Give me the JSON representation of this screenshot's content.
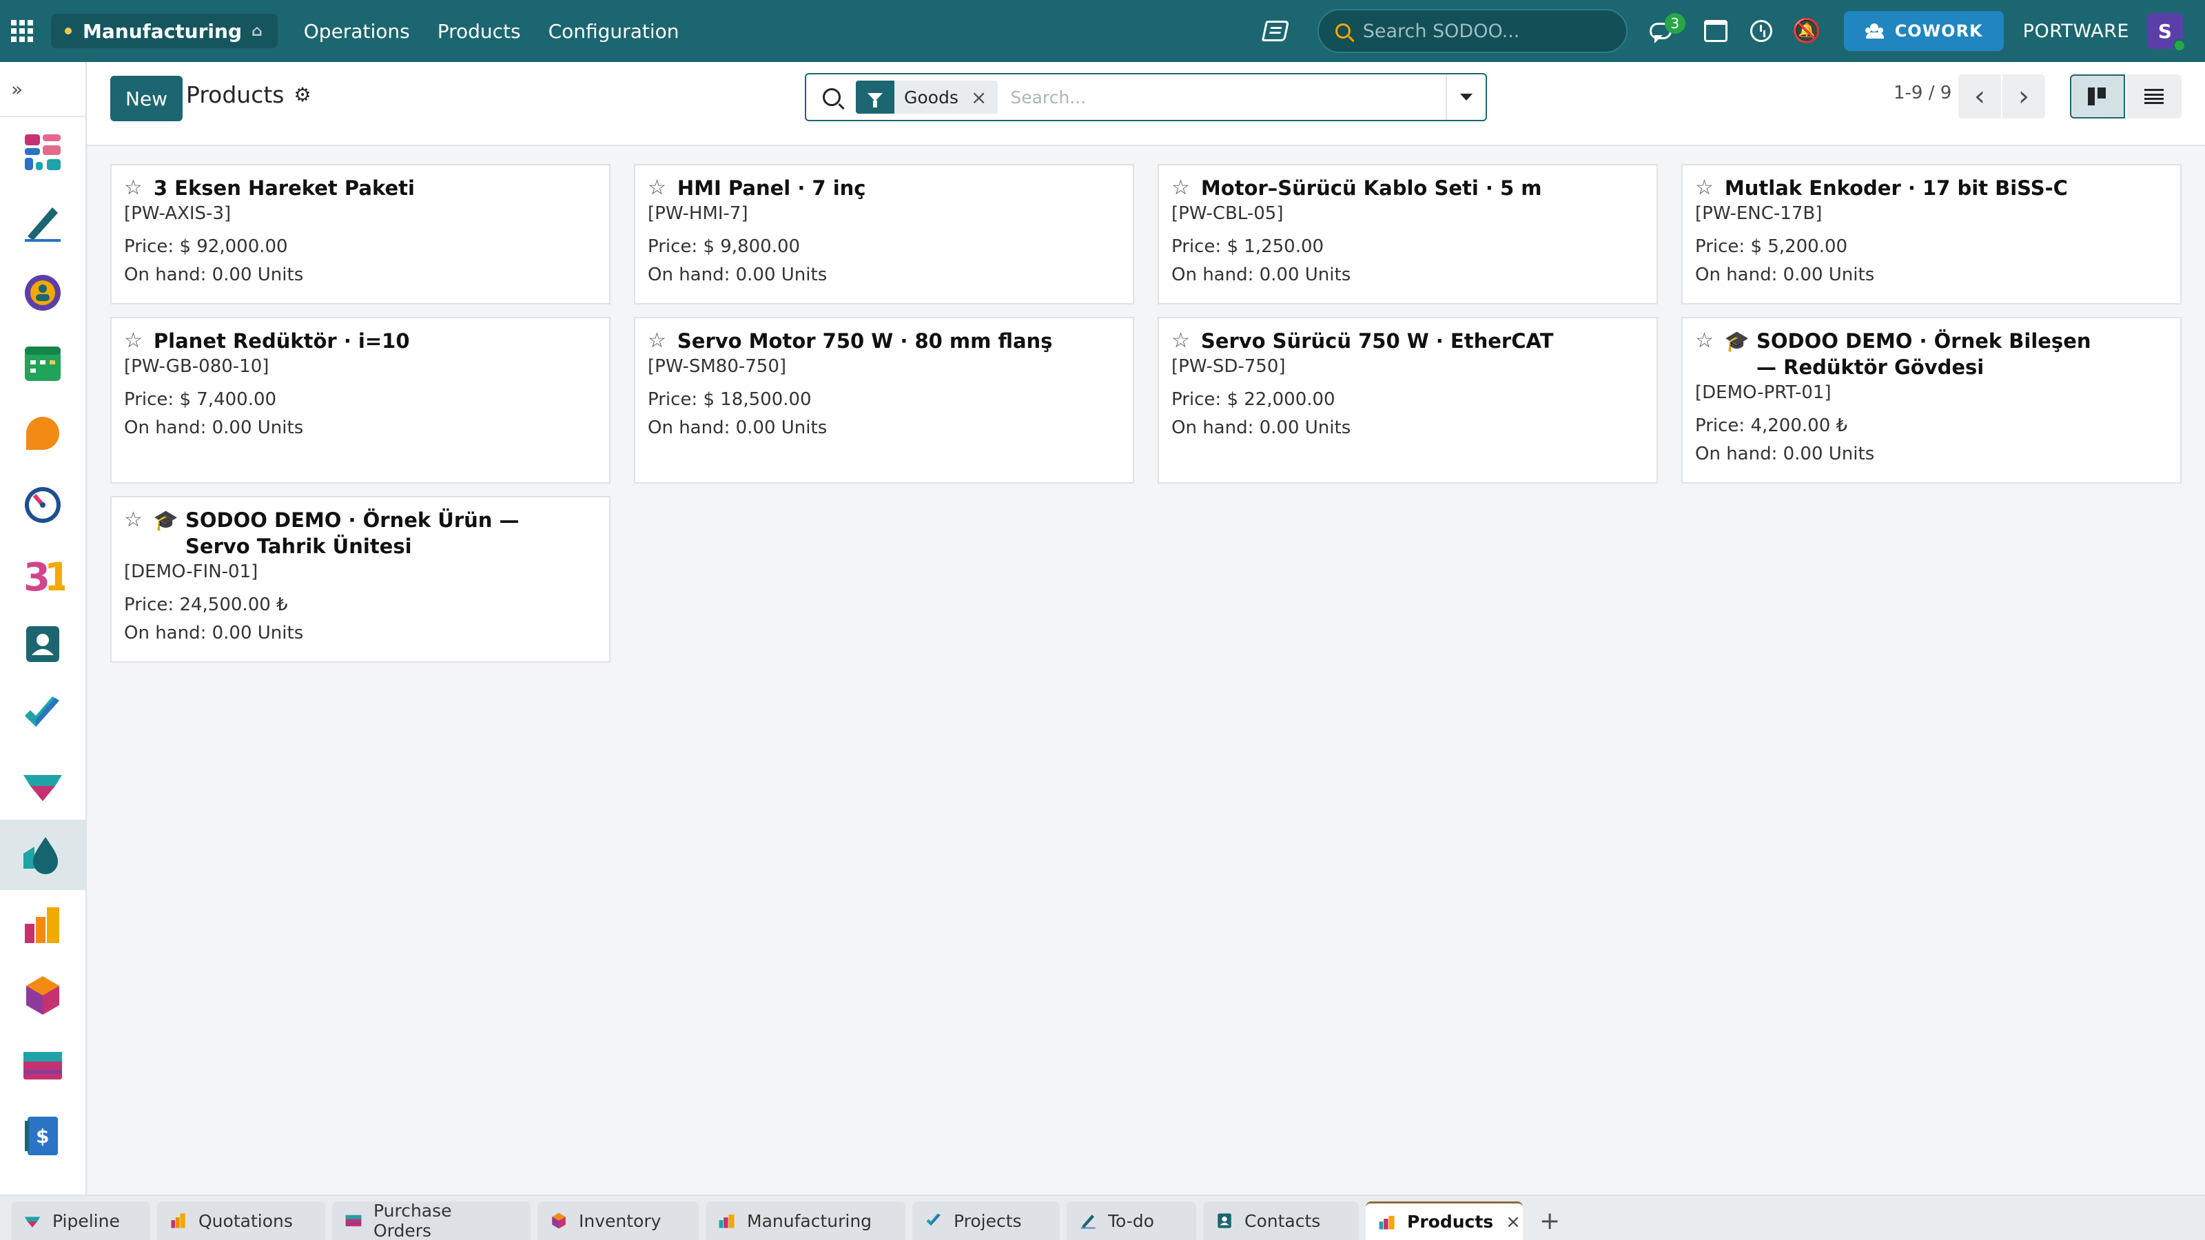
{
  "navbar": {
    "app_name": "Manufacturing",
    "menus": [
      "Operations",
      "Products",
      "Configuration"
    ],
    "search_placeholder": "Search SODOO...",
    "chat_badge": "3",
    "cowork_label": "COWORK",
    "company": "PORTWARE",
    "avatar_letter": "S",
    "home_icon": "home-icon",
    "bell_icon": "bell-off-icon"
  },
  "sidebar": {
    "toggle": "»",
    "apps": [
      {
        "name": "dashboards",
        "icon": "dashboard-icon"
      },
      {
        "name": "sign",
        "icon": "pen-icon"
      },
      {
        "name": "discuss",
        "icon": "discuss-icon"
      },
      {
        "name": "calendar-app",
        "icon": "calendar-app-icon"
      },
      {
        "name": "crm",
        "icon": "crm-icon"
      },
      {
        "name": "timesheets",
        "icon": "timer-icon"
      },
      {
        "name": "events",
        "icon": "events-icon"
      },
      {
        "name": "contacts",
        "icon": "contacts-icon"
      },
      {
        "name": "todo",
        "icon": "check-icon"
      },
      {
        "name": "pipeline",
        "icon": "pipeline-icon"
      },
      {
        "name": "manufacturing",
        "icon": "droplet-icon"
      },
      {
        "name": "sales",
        "icon": "bar-chart-icon"
      },
      {
        "name": "inventory",
        "icon": "cube-icon"
      },
      {
        "name": "purchase",
        "icon": "card-icon"
      },
      {
        "name": "invoicing",
        "icon": "invoice-icon"
      }
    ]
  },
  "control": {
    "new_label": "New",
    "breadcrumb": "Products",
    "facet_label": "Goods",
    "facet_close": "×",
    "search_placeholder": "Search...",
    "pager": "1-9 / 9",
    "prev": "‹",
    "next": "›"
  },
  "products": [
    {
      "name": "3 Eksen Hareket Paketi",
      "code": "[PW-AXIS-3]",
      "price": "Price: $ 92,000.00",
      "onhand": "On hand: 0.00 Units",
      "demo": false
    },
    {
      "name": "HMI Panel · 7 inç",
      "code": "[PW-HMI-7]",
      "price": "Price: $ 9,800.00",
      "onhand": "On hand: 0.00 Units",
      "demo": false
    },
    {
      "name": "Motor–Sürücü Kablo Seti · 5 m",
      "code": "[PW-CBL-05]",
      "price": "Price: $ 1,250.00",
      "onhand": "On hand: 0.00 Units",
      "demo": false
    },
    {
      "name": "Mutlak Enkoder · 17 bit BiSS-C",
      "code": "[PW-ENC-17B]",
      "price": "Price: $ 5,200.00",
      "onhand": "On hand: 0.00 Units",
      "demo": false
    },
    {
      "name": "Planet Redüktör · i=10",
      "code": "[PW-GB-080-10]",
      "price": "Price: $ 7,400.00",
      "onhand": "On hand: 0.00 Units",
      "demo": false
    },
    {
      "name": "Servo Motor 750 W · 80 mm flanş",
      "code": "[PW-SM80-750]",
      "price": "Price: $ 18,500.00",
      "onhand": "On hand: 0.00 Units",
      "demo": false
    },
    {
      "name": "Servo Sürücü 750 W · EtherCAT",
      "code": "[PW-SD-750]",
      "price": "Price: $ 22,000.00",
      "onhand": "On hand: 0.00 Units",
      "demo": false
    },
    {
      "name": "SODOO DEMO · Örnek Bileşen — Redüktör Gövdesi",
      "code": "[DEMO-PRT-01]",
      "price": "Price: 4,200.00 ₺",
      "onhand": "On hand: 0.00 Units",
      "demo": true
    },
    {
      "name": "SODOO DEMO · Örnek Ürün — Servo Tahrik Ünitesi",
      "code": "[DEMO-FIN-01]",
      "price": "Price: 24,500.00 ₺",
      "onhand": "On hand: 0.00 Units",
      "demo": true
    }
  ],
  "tabs": [
    {
      "label": "Pipeline",
      "icon": "pipeline-icon",
      "active": false
    },
    {
      "label": "Quotations",
      "icon": "bar-chart-icon",
      "active": false
    },
    {
      "label": "Purchase Orders",
      "icon": "card-icon",
      "active": false
    },
    {
      "label": "Inventory",
      "icon": "cube-icon",
      "active": false
    },
    {
      "label": "Manufacturing",
      "icon": "factory-icon",
      "active": false
    },
    {
      "label": "Projects",
      "icon": "check-icon",
      "active": false
    },
    {
      "label": "To-do",
      "icon": "pen-icon",
      "active": false
    },
    {
      "label": "Contacts",
      "icon": "contacts-icon",
      "active": false
    },
    {
      "label": "Products",
      "icon": "factory-icon",
      "active": true
    }
  ],
  "tab_close": "×",
  "tab_add": "+",
  "colors": {
    "brand": "#1b6670",
    "brand_dark": "#15565e",
    "cowork": "#2185bf",
    "avatar": "#5b3fa8",
    "badge": "#28a745",
    "background": "#f4f5f7"
  }
}
